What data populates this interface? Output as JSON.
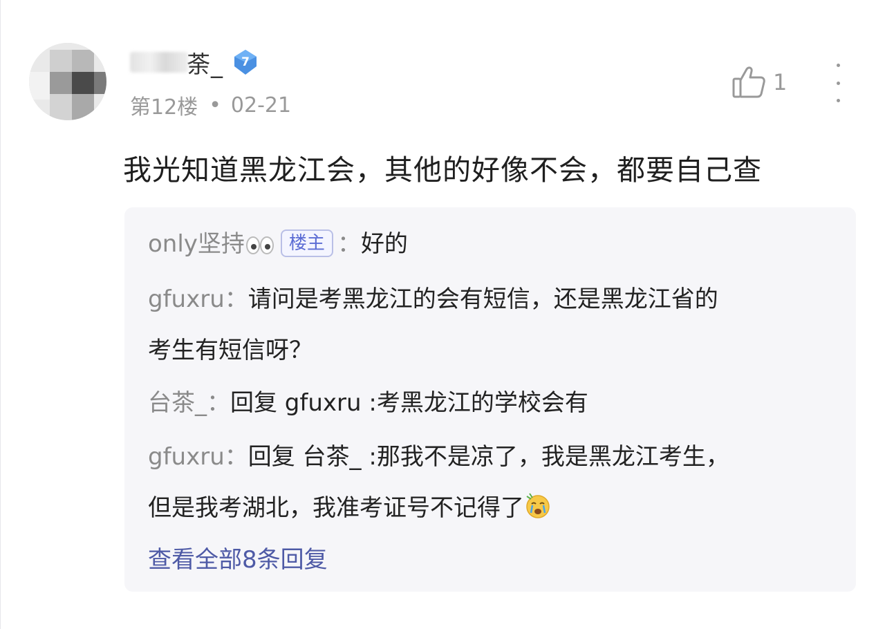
{
  "comment": {
    "username_visible": "荼_",
    "level": "7",
    "floor": "第12楼",
    "separator": "•",
    "date": "02-21",
    "likes": "1",
    "text": "我光知道黑龙江会，其他的好像不会，都要自己查"
  },
  "replies": [
    {
      "user": "only坚持",
      "tag": "楼主",
      "separator": "：",
      "text": "好的"
    },
    {
      "user": "gfuxru",
      "separator": "：",
      "lines": [
        "请问是考黑龙江的会有短信，还是黑龙江省的",
        "考生有短信呀？"
      ]
    },
    {
      "user": "台茶_",
      "separator": "：",
      "text": "回复 gfuxru :考黑龙江的学校会有"
    },
    {
      "user": "gfuxru",
      "separator": "：",
      "lines": [
        "回复 台茶_ :那我不是凉了，我是黑龙江考生，",
        "但是我考湖北，我准考证号不记得了"
      ]
    }
  ],
  "view_all": "查看全部8条回复",
  "colors": {
    "badge": "#4a90e2",
    "link": "#4e5aa6",
    "tag": "#5b6cd4",
    "reply_bg": "#f6f6f9"
  },
  "icons": [
    "thumbs-up-icon",
    "more-vert-icon",
    "eyes-emoji-icon",
    "crying-emoji-icon",
    "level-badge-icon"
  ]
}
